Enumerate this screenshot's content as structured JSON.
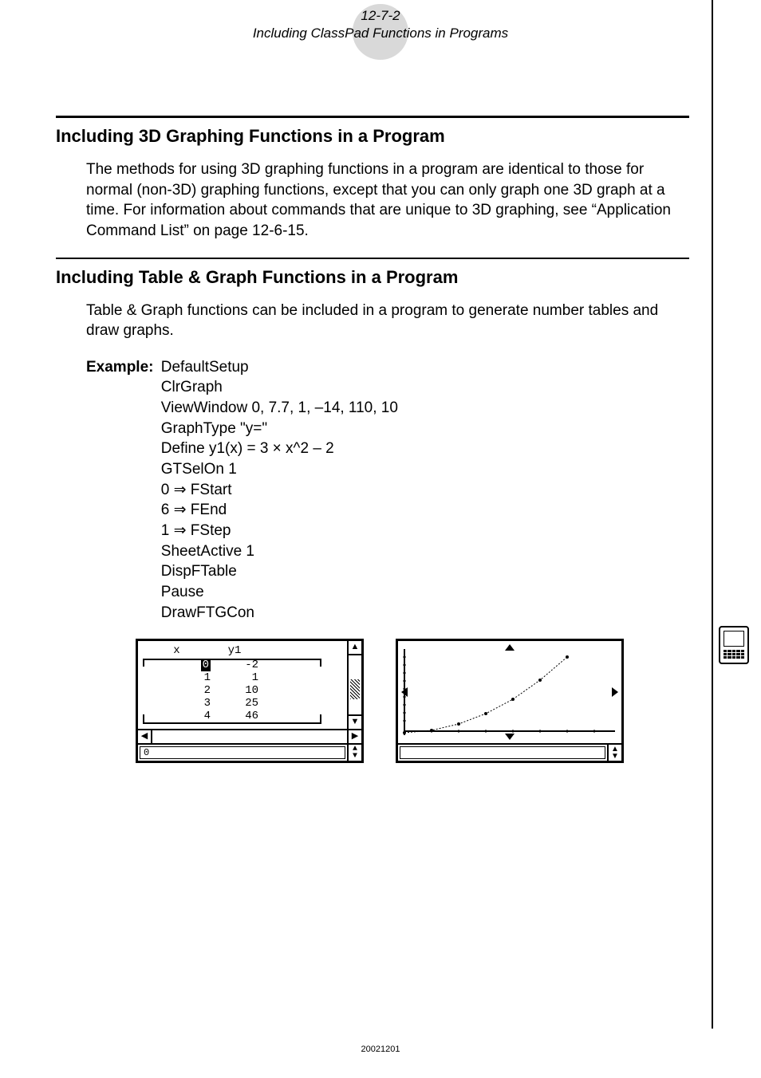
{
  "header": {
    "page_number": "12-7-2",
    "subtitle": "Including ClassPad Functions in Programs"
  },
  "section1": {
    "heading": "Including 3D Graphing Functions in a Program",
    "body": "The methods for using 3D graphing functions in a program are identical to those for normal (non-3D) graphing functions, except that you can only graph one 3D graph at a time. For information about commands that are unique to 3D graphing, see “Application Command List” on page 12-6-15."
  },
  "section2": {
    "heading": "Including Table & Graph Functions in a Program",
    "body": "Table & Graph functions can be included in a program to generate number tables and draw graphs.",
    "example_label": "Example:",
    "code": {
      "l0": "DefaultSetup",
      "l1": "ClrGraph",
      "l2": "ViewWindow 0, 7.7, 1, –14, 110, 10",
      "l3": "GraphType \"y=\"",
      "l4": "Define y1(x) = 3 × x^2 – 2",
      "l5": "GTSelOn 1",
      "l6": "0 ⇒ FStart",
      "l7": "6 ⇒ FEnd",
      "l8": "1 ⇒ FStep",
      "l9": "SheetActive 1",
      "l10": "DispFTable",
      "l11": "Pause",
      "l12": "DrawFTGCon"
    }
  },
  "table_shot": {
    "col_x": "x",
    "col_y": "y1",
    "rows": [
      {
        "x": "0",
        "y": "-2",
        "selected": true
      },
      {
        "x": "1",
        "y": "1"
      },
      {
        "x": "2",
        "y": "10"
      },
      {
        "x": "3",
        "y": "25"
      },
      {
        "x": "4",
        "y": "46"
      }
    ],
    "status_value": "0"
  },
  "chart_data": {
    "type": "line",
    "x": [
      0,
      1,
      2,
      3,
      4,
      5,
      6
    ],
    "y": [
      -2,
      1,
      10,
      25,
      46,
      73,
      106
    ],
    "title": "",
    "xlabel": "",
    "ylabel": "",
    "xlim": [
      0,
      7.7
    ],
    "ylim": [
      -14,
      110
    ]
  },
  "footer_code": "20021201"
}
